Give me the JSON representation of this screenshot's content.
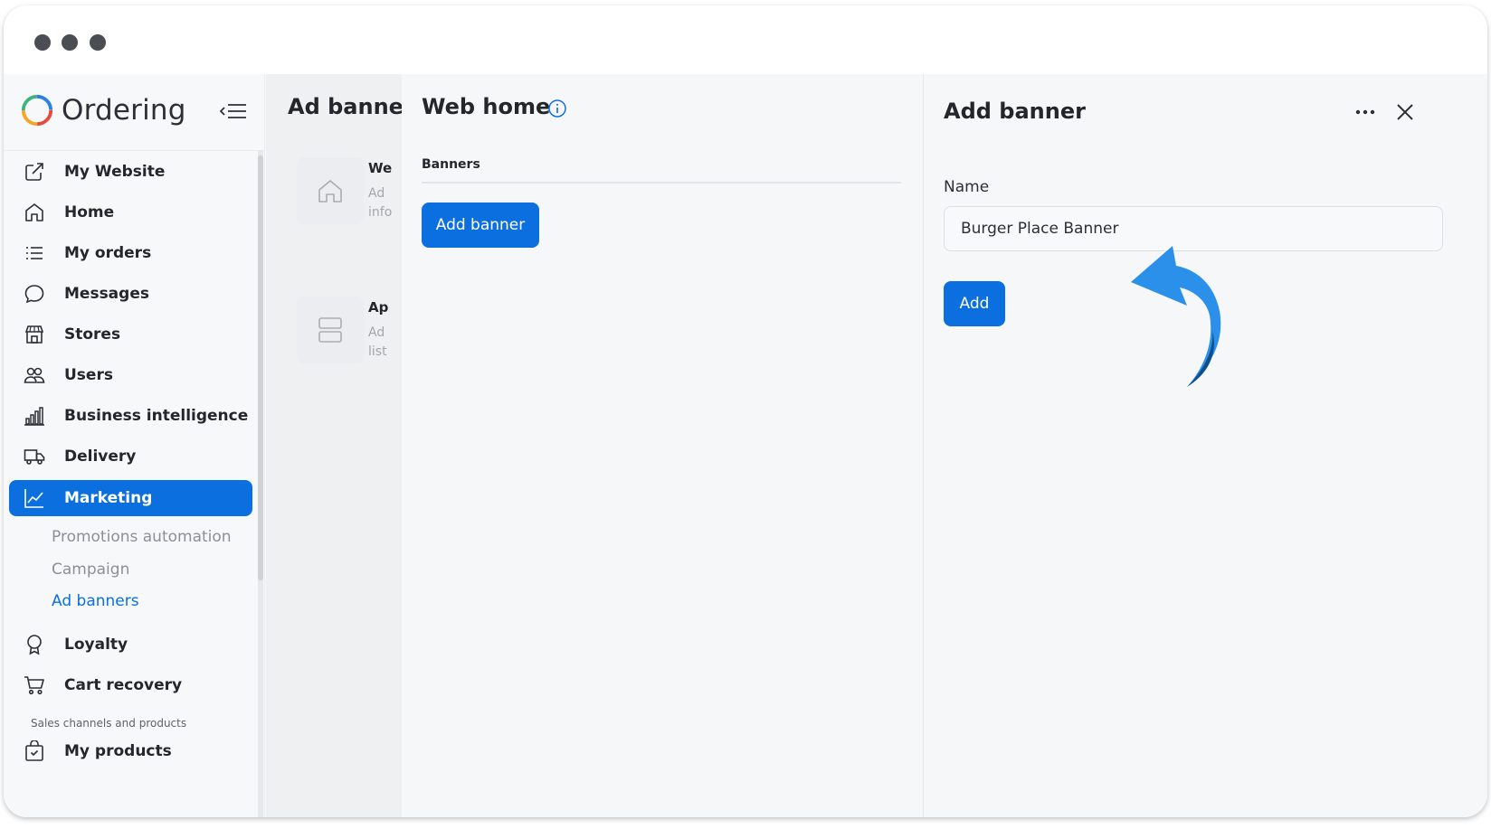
{
  "brand": {
    "name": "Ordering"
  },
  "sidebar": {
    "items": [
      {
        "label": "My Website",
        "icon": "external-link-icon"
      },
      {
        "label": "Home",
        "icon": "home-icon"
      },
      {
        "label": "My orders",
        "icon": "list-icon"
      },
      {
        "label": "Messages",
        "icon": "chat-bubble-icon"
      },
      {
        "label": "Stores",
        "icon": "store-icon"
      },
      {
        "label": "Users",
        "icon": "users-icon"
      },
      {
        "label": "Business intelligence",
        "icon": "bar-chart-icon"
      },
      {
        "label": "Delivery",
        "icon": "truck-icon"
      },
      {
        "label": "Marketing",
        "icon": "line-chart-icon",
        "active": true
      },
      {
        "label": "Loyalty",
        "icon": "award-icon"
      },
      {
        "label": "Cart recovery",
        "icon": "cart-icon"
      },
      {
        "label": "My products",
        "icon": "bag-icon"
      }
    ],
    "subitems": [
      "Promotions automation",
      "Campaign",
      "Ad banners"
    ],
    "section_label": "Sales channels and products"
  },
  "background_panel": {
    "title": "Ad banner",
    "cards": [
      {
        "title": "We",
        "line1": "Ad",
        "line2": "info"
      },
      {
        "title": "Ap",
        "line1": "Ad",
        "line2": "list"
      }
    ]
  },
  "middle": {
    "title": "Web home",
    "tab": "Banners",
    "add_button": "Add banner"
  },
  "right": {
    "title": "Add banner",
    "name_label": "Name",
    "name_value": "Burger Place Banner",
    "add_button": "Add"
  },
  "colors": {
    "accent": "#0b6fe0",
    "annotation_arrow": "#2b90ea"
  }
}
